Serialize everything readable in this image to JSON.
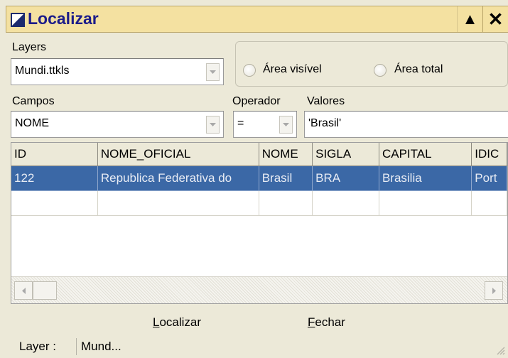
{
  "window": {
    "title": "Localizar",
    "collapse_icon": "▲",
    "close_icon": "✕"
  },
  "layers": {
    "label": "Layers",
    "value": "Mundi.ttkls"
  },
  "area": {
    "option_visible": "Área visível",
    "option_total": "Área total"
  },
  "campos": {
    "label": "Campos",
    "value": "NOME"
  },
  "operador": {
    "label": "Operador",
    "value": "="
  },
  "valores": {
    "label": "Valores",
    "value": "'Brasil'"
  },
  "table": {
    "columns": [
      "ID",
      "NOME_OFICIAL",
      "NOME",
      "SIGLA",
      "CAPITAL",
      "IDIC"
    ],
    "rows": [
      [
        "122",
        "Republica Federativa do",
        "Brasil",
        "BRA",
        "Brasilia",
        "Port"
      ],
      [
        "",
        "",
        "",
        "",
        "",
        ""
      ]
    ]
  },
  "buttons": {
    "localizar_first": "L",
    "localizar_rest": "ocalizar",
    "fechar_first": "F",
    "fechar_rest": "echar"
  },
  "status": {
    "label": "Layer :",
    "value": "Mund..."
  }
}
